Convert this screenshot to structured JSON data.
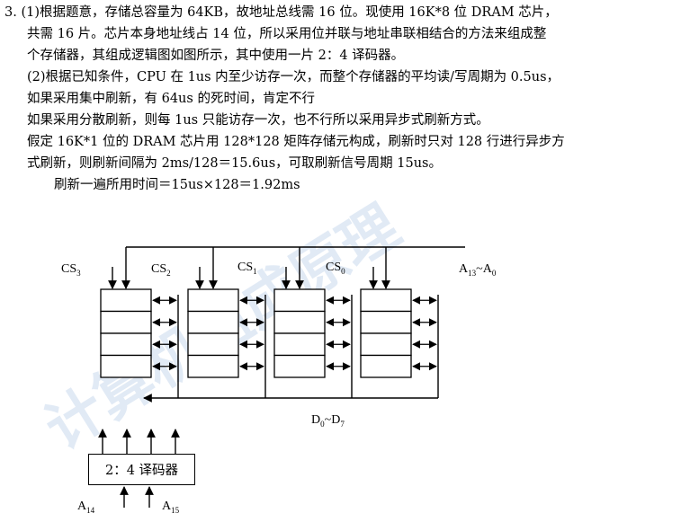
{
  "text_lines": [
    "3. (1)根据题意，存储总容量为 64KB，故地址总线需 16 位。现使用 16K*8 位 DRAM 芯片，",
    "共需 16 片。芯片本身地址线占 14 位，所以采用位并联与地址串联相结合的方法来组成整",
    "个存储器，其组成逻辑图如图所示，其中使用一片 2：4 译码器。",
    "(2)根据已知条件，CPU 在 1us 内至少访存一次，而整个存储器的平均读/写周期为 0.5us，",
    "如果采用集中刷新，有 64us 的死时间，肯定不行",
    "如果采用分散刷新，则每 1us 只能访存一次，也不行所以采用异步式刷新方式。",
    "假定 16K*1 位的 DRAM 芯片用 128*128 矩阵存储元构成，刷新时只对 128 行进行异步方",
    "式刷新，则刷新间隔为 2ms/128＝15.6us，可取刷新信号周期 15us。",
    "刷新一遍所用时间＝15us×128＝1.92ms"
  ],
  "diagram": {
    "cs_labels": [
      {
        "base": "CS",
        "sub": "3"
      },
      {
        "base": "CS",
        "sub": "2"
      },
      {
        "base": "CS",
        "sub": "1"
      },
      {
        "base": "CS",
        "sub": "0"
      }
    ],
    "address_label": {
      "base": "A",
      "sub1": "13",
      "mid": "~A",
      "sub2": "0"
    },
    "data_label": {
      "base": "D",
      "sub1": "0",
      "mid": "~D",
      "sub2": "7"
    },
    "decoder_label": "2：4 译码器",
    "decoder_inputs": [
      {
        "base": "A",
        "sub": "14"
      },
      {
        "base": "A",
        "sub": "15"
      }
    ]
  },
  "watermark": "计算机组成原理"
}
